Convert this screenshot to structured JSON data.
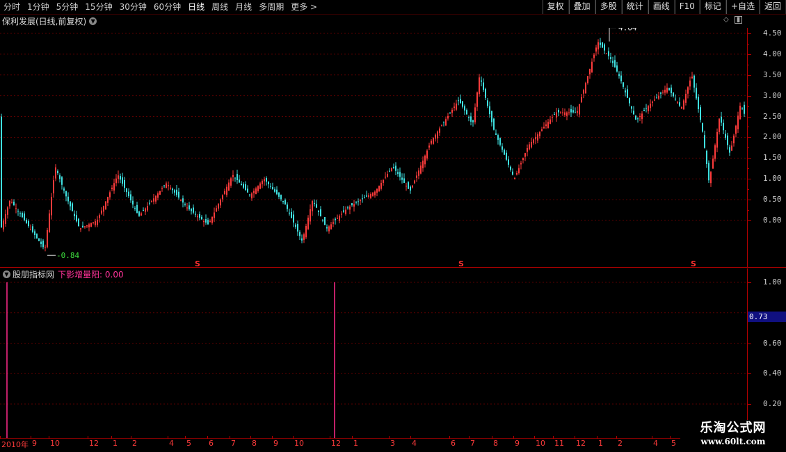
{
  "toolbar": {
    "periods": [
      "分时",
      "1分钟",
      "5分钟",
      "15分钟",
      "30分钟",
      "60分钟",
      "日线",
      "周线",
      "月线",
      "多周期",
      "更多 >"
    ],
    "active_period": "日线",
    "buttons": [
      "复权",
      "叠加",
      "多股",
      "统计",
      "画线",
      "F10",
      "标记",
      "+自选",
      "返回"
    ]
  },
  "main_chart": {
    "title": "保利发展(日线,前复权)",
    "high_marker": "4.64",
    "low_marker": "-0.84",
    "y_axis_labels": [
      "4.50",
      "4.00",
      "3.50",
      "3.00",
      "2.50",
      "2.00",
      "1.50",
      "1.00",
      "0.50",
      "0.00"
    ],
    "s_markers": [
      "S",
      "S",
      "S"
    ],
    "up_color": "#ff3b3b",
    "down_color": "#3fe0e0"
  },
  "indicator": {
    "name": "股朋指标网",
    "series_label": "下影增量阳: 0.00",
    "y_axis_labels": [
      "1.00",
      "0.60",
      "0.40",
      "0.20"
    ],
    "cursor_value": "0.73",
    "color": "#ff2a8a"
  },
  "date_axis": [
    "2010年",
    "9",
    "10",
    "12",
    "1",
    "2",
    "4",
    "5",
    "6",
    "7",
    "8",
    "9",
    "10",
    "12",
    "1",
    "3",
    "4",
    "6",
    "7",
    "8",
    "9",
    "10",
    "11",
    "12",
    "1",
    "2",
    "4",
    "5"
  ],
  "watermark": {
    "title": "乐淘公式网",
    "url": "www.60lt.com"
  }
}
